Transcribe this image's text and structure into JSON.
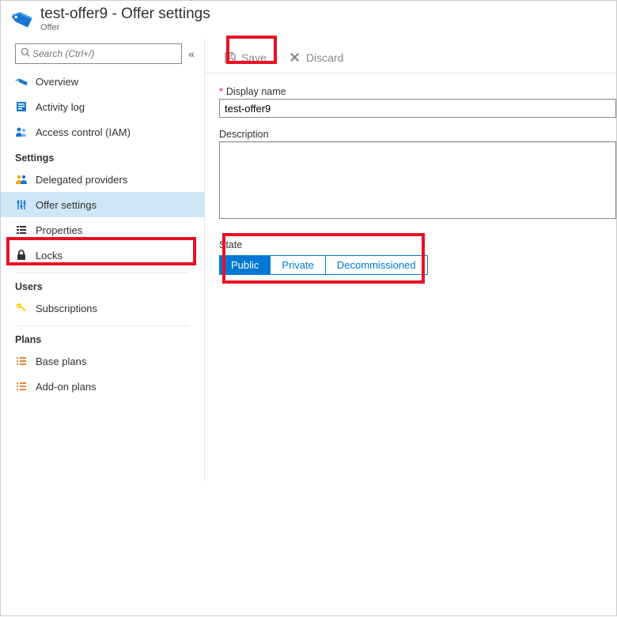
{
  "header": {
    "title": "test-offer9 - Offer settings",
    "subtitle": "Offer"
  },
  "search": {
    "placeholder": "Search (Ctrl+/)"
  },
  "nav": {
    "top": [
      {
        "label": "Overview"
      },
      {
        "label": "Activity log"
      },
      {
        "label": "Access control (IAM)"
      }
    ],
    "sections": {
      "settings": {
        "title": "Settings",
        "items": [
          {
            "label": "Delegated providers"
          },
          {
            "label": "Offer settings"
          },
          {
            "label": "Properties"
          },
          {
            "label": "Locks"
          }
        ]
      },
      "users": {
        "title": "Users",
        "items": [
          {
            "label": "Subscriptions"
          }
        ]
      },
      "plans": {
        "title": "Plans",
        "items": [
          {
            "label": "Base plans"
          },
          {
            "label": "Add-on plans"
          }
        ]
      }
    }
  },
  "toolbar": {
    "save_label": "Save",
    "discard_label": "Discard"
  },
  "form": {
    "display_name_label": "Display name",
    "display_name_value": "test-offer9",
    "description_label": "Description",
    "description_value": "",
    "state_label": "State",
    "state_options": [
      "Public",
      "Private",
      "Decommissioned"
    ],
    "state_selected": "Public"
  }
}
